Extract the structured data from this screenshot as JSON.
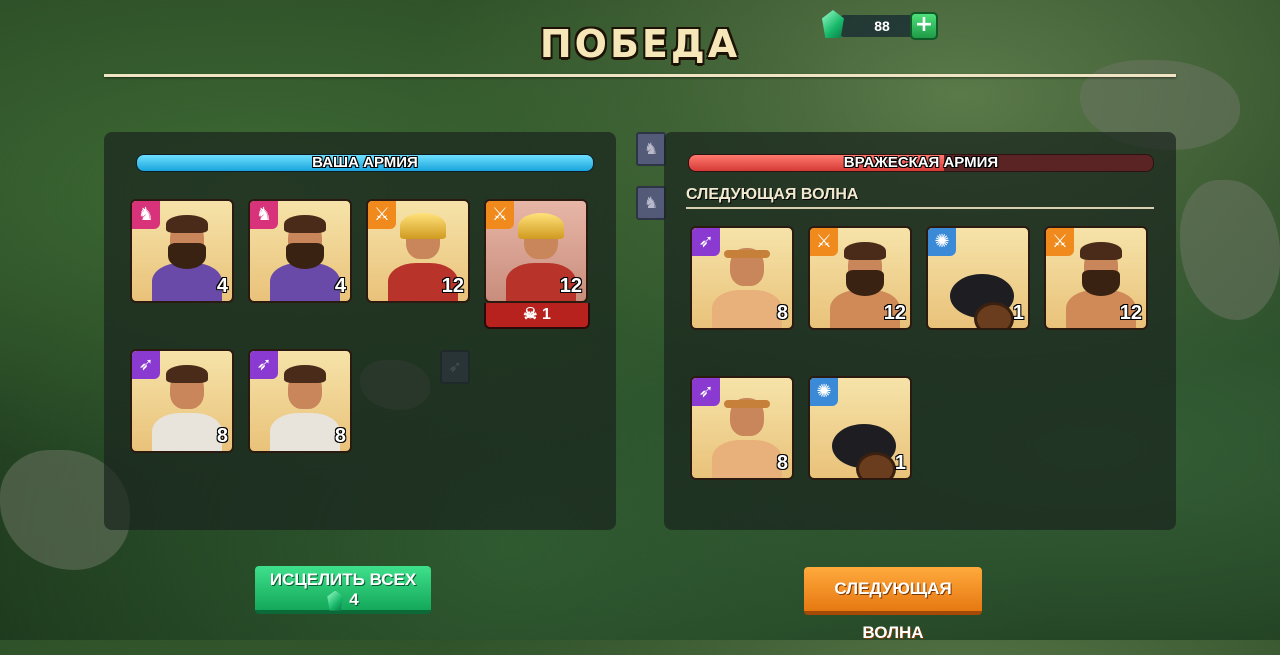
{
  "header": {
    "title": "ПОБЕДА"
  },
  "currency": {
    "gems": "88",
    "add_label": "+"
  },
  "player_army": {
    "label": "ВАША АРМИЯ",
    "health_percent": 100,
    "units": [
      {
        "type": "cavalry",
        "icon": "horse-icon",
        "count": "4",
        "dead": false
      },
      {
        "type": "cavalry",
        "icon": "horse-icon",
        "count": "4",
        "dead": false
      },
      {
        "type": "infantry",
        "icon": "sword-icon",
        "count": "12",
        "dead": false
      },
      {
        "type": "infantry",
        "icon": "sword-icon",
        "count": "12",
        "dead": true,
        "losses": "1"
      },
      {
        "type": "archer",
        "icon": "bow-icon",
        "count": "8",
        "dead": false
      },
      {
        "type": "archer",
        "icon": "bow-icon",
        "count": "8",
        "dead": false
      }
    ]
  },
  "enemy_army": {
    "label": "ВРАЖЕСКАЯ АРМИЯ",
    "health_percent": 55,
    "next_wave_label": "СЛЕДУЮЩАЯ ВОЛНА",
    "units": [
      {
        "type": "archer",
        "icon": "bow-icon",
        "count": "8"
      },
      {
        "type": "infantry",
        "icon": "sword-icon",
        "count": "12"
      },
      {
        "type": "siege",
        "icon": "cannon-icon",
        "count": "1"
      },
      {
        "type": "infantry",
        "icon": "sword-icon",
        "count": "12"
      },
      {
        "type": "archer",
        "icon": "bow-icon",
        "count": "8"
      },
      {
        "type": "siege",
        "icon": "cannon-icon",
        "count": "1"
      }
    ]
  },
  "buttons": {
    "heal_all": {
      "label": "ИСЦЕЛИТЬ ВСЕХ",
      "cost": "4"
    },
    "next_wave": {
      "label": "СЛЕДУЮЩАЯ ВОЛНА"
    }
  },
  "colors": {
    "cavalry": "#d8337a",
    "infantry": "#f08a1c",
    "archer": "#8a3ad0",
    "siege": "#3a8ad8",
    "player_bar": "#1aa4dc",
    "enemy_bar": "#d43a36"
  }
}
